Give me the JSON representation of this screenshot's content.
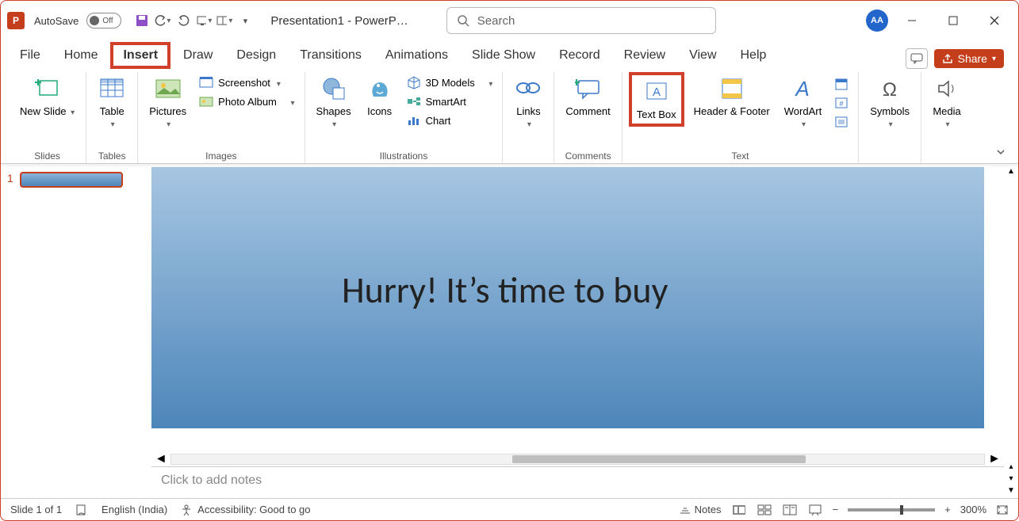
{
  "app": {
    "letter": "P",
    "autosave_label": "AutoSave",
    "autosave_state": "Off",
    "title": "Presentation1 - PowerP…",
    "search_placeholder": "Search",
    "user_initials": "AA"
  },
  "tabs": {
    "file": "File",
    "home": "Home",
    "insert": "Insert",
    "draw": "Draw",
    "design": "Design",
    "transitions": "Transitions",
    "animations": "Animations",
    "slideshow": "Slide Show",
    "record": "Record",
    "review": "Review",
    "view": "View",
    "help": "Help",
    "share": "Share"
  },
  "ribbon": {
    "groups": {
      "slides": "Slides",
      "tables": "Tables",
      "images": "Images",
      "illustrations": "Illustrations",
      "links_group": "",
      "comments": "Comments",
      "text": "Text"
    },
    "new_slide": "New Slide",
    "table": "Table",
    "pictures": "Pictures",
    "screenshot": "Screenshot",
    "photo_album": "Photo Album",
    "shapes": "Shapes",
    "icons": "Icons",
    "models3d": "3D Models",
    "smartart": "SmartArt",
    "chart": "Chart",
    "links": "Links",
    "comment": "Comment",
    "text_box": "Text Box",
    "header_footer": "Header & Footer",
    "wordart": "WordArt",
    "symbols": "Symbols",
    "media": "Media"
  },
  "slide": {
    "number": "1",
    "body_text": "Hurry! It’s time to buy"
  },
  "notes": {
    "placeholder": "Click to add notes"
  },
  "status": {
    "slide_info": "Slide 1 of 1",
    "language": "English (India)",
    "accessibility": "Accessibility: Good to go",
    "notes_btn": "Notes",
    "zoom": "300%"
  }
}
